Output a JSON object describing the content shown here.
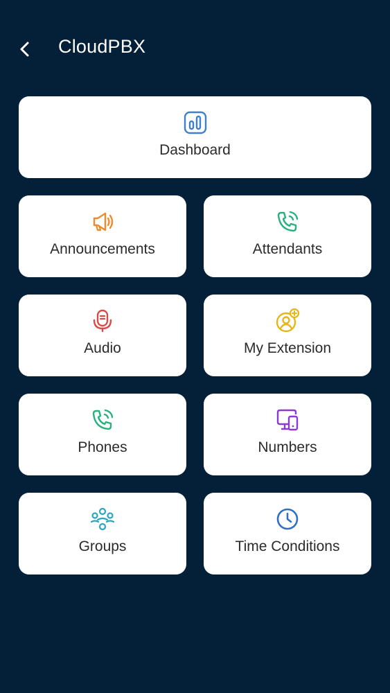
{
  "header": {
    "title": "CloudPBX",
    "back_icon": "chevron-left-icon"
  },
  "menu": {
    "dashboard": {
      "label": "Dashboard",
      "icon": "bar-chart-icon",
      "color": "#3d7fd0"
    },
    "announcements": {
      "label": "Announcements",
      "icon": "megaphone-icon",
      "color": "#ec8a2c"
    },
    "attendants": {
      "label": "Attendants",
      "icon": "phone-call-icon",
      "color": "#27b17e"
    },
    "audio": {
      "label": "Audio",
      "icon": "microphone-icon",
      "color": "#d94a4a"
    },
    "my_extension": {
      "label": "My Extension",
      "icon": "user-add-icon",
      "color": "#e6b619"
    },
    "phones": {
      "label": "Phones",
      "icon": "phone-call-icon",
      "color": "#27b17e"
    },
    "numbers": {
      "label": "Numbers",
      "icon": "devices-icon",
      "color": "#8a3ad0"
    },
    "groups": {
      "label": "Groups",
      "icon": "users-group-icon",
      "color": "#2aa6bf"
    },
    "time_conditions": {
      "label": "Time Conditions",
      "icon": "clock-icon",
      "color": "#2f6fc4"
    }
  }
}
